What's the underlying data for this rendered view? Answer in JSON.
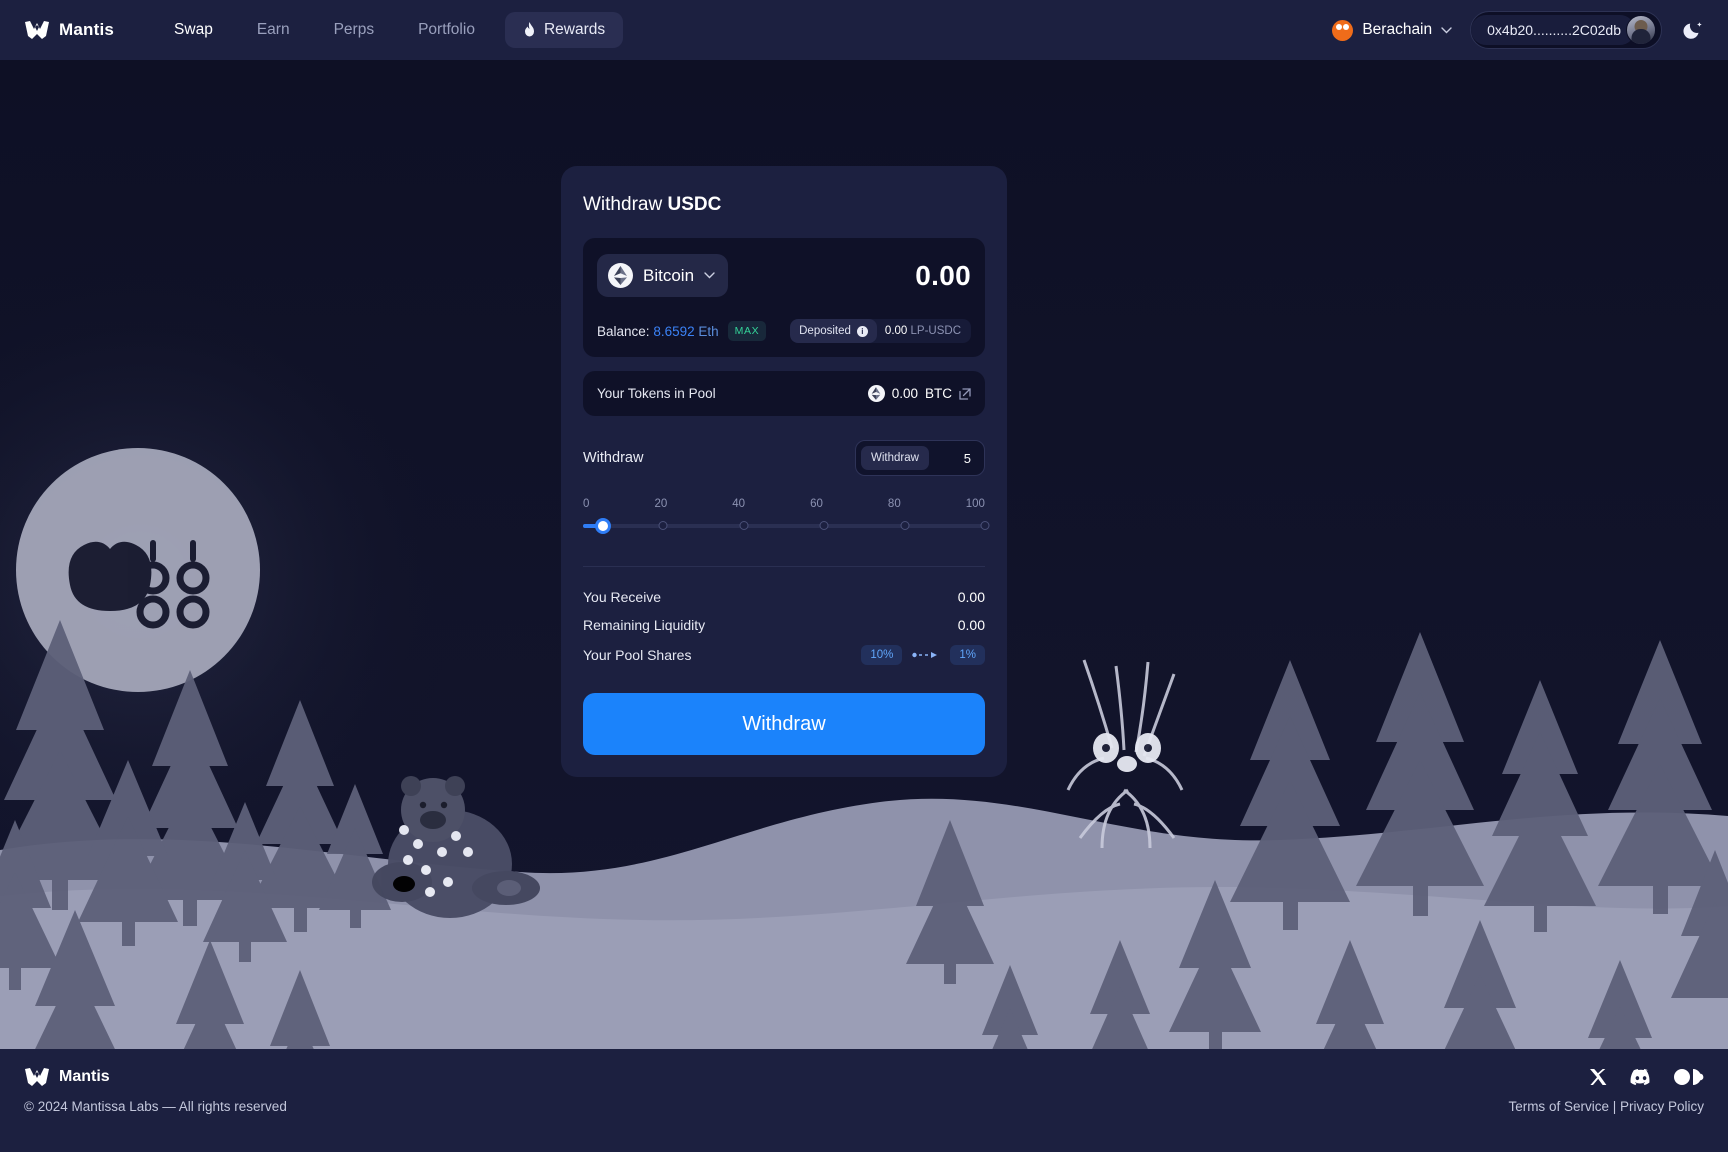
{
  "header": {
    "brand": "Mantis",
    "nav": [
      {
        "label": "Swap",
        "state": "active"
      },
      {
        "label": "Earn",
        "state": "idle"
      },
      {
        "label": "Perps",
        "state": "idle"
      },
      {
        "label": "Portfolio",
        "state": "idle"
      },
      {
        "label": "Rewards",
        "state": "pill"
      }
    ],
    "chain": "Berachain",
    "wallet_address": "0x4b20..........2C02db",
    "theme_icon": "moon-icon"
  },
  "card": {
    "title_prefix": "Withdraw",
    "title_token": "USDC",
    "token": {
      "name": "Bitcoin",
      "amount": "0.00",
      "balance_label": "Balance:",
      "balance_value": "8.6592",
      "balance_unit": "Eth",
      "max_label": "MAX",
      "deposited_label": "Deposited",
      "deposited_value": "0.00",
      "deposited_unit": "LP-USDC"
    },
    "pool": {
      "label": "Your Tokens in Pool",
      "value": "0.00",
      "unit": "BTC"
    },
    "withdraw": {
      "label": "Withdraw",
      "input_tag": "Withdraw",
      "input_value": "5",
      "slider_ticks": [
        "0",
        "20",
        "40",
        "60",
        "80",
        "100"
      ],
      "slider_value": 5,
      "slider_min": 0,
      "slider_max": 100
    },
    "summary": [
      {
        "label": "You Receive",
        "value": "0.00"
      },
      {
        "label": "Remaining Liquidity",
        "value": "0.00"
      }
    ],
    "pool_shares": {
      "label": "Your Pool Shares",
      "from": "10%",
      "to": "1%"
    },
    "cta_label": "Withdraw"
  },
  "footer": {
    "brand": "Mantis",
    "copyright": "© 2024 Mantissa Labs — All rights reserved",
    "legal": "Terms of Service | Privacy Policy",
    "socials": [
      "x-icon",
      "discord-icon",
      "mantis-circles-icon"
    ]
  },
  "colors": {
    "accent": "#1b83fb",
    "panel": "#1c2040",
    "inner": "#0f1128",
    "link": "#3b82f6",
    "green": "#34d399",
    "chain": "#ef6c1a"
  }
}
